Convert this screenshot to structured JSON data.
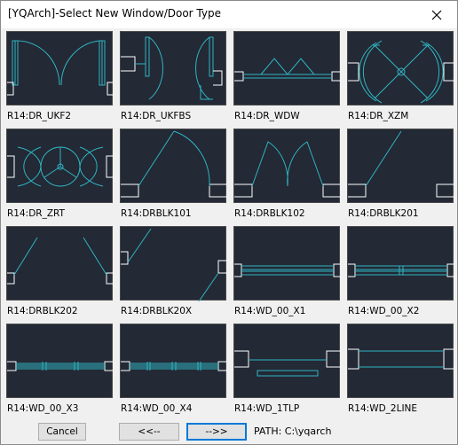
{
  "window": {
    "title": "[YQArch]-Select New Window/Door Type"
  },
  "colors": {
    "thumb_bg": "#232935",
    "line": "#2fb5c2"
  },
  "items": [
    {
      "label": "R14:DR_UKF2",
      "icon": "double-swing-door"
    },
    {
      "label": "R14:DR_UKFBS",
      "icon": "unequal-double-door"
    },
    {
      "label": "R14:DR_WDW",
      "icon": "window-with-swing-arcs"
    },
    {
      "label": "R14:DR_XZM",
      "icon": "revolving-door"
    },
    {
      "label": "R14:DR_ZRT",
      "icon": "three-wing-revolving-door"
    },
    {
      "label": "R14:DRBLK101",
      "icon": "single-swing-door"
    },
    {
      "label": "R14:DRBLK102",
      "icon": "double-swing-door"
    },
    {
      "label": "R14:DRBLK201",
      "icon": "single-door-line"
    },
    {
      "label": "R14:DRBLK202",
      "icon": "double-door-lines"
    },
    {
      "label": "R14:DRBLK20X",
      "icon": "double-door-lines"
    },
    {
      "label": "R14:WD_00_X1",
      "icon": "window-frame"
    },
    {
      "label": "R14:WD_00_X2",
      "icon": "window-frame"
    },
    {
      "label": "R14:WD_00_X3",
      "icon": "window-frame"
    },
    {
      "label": "R14:WD_00_X4",
      "icon": "window-frame"
    },
    {
      "label": "R14:WD_1TLP",
      "icon": "window-sill"
    },
    {
      "label": "R14:WD_2LINE",
      "icon": "window-two-lines"
    }
  ],
  "buttons": {
    "cancel": "Cancel",
    "prev": "<<--",
    "next": "-->>"
  },
  "path_text": "PATH: C:\\yqarch"
}
